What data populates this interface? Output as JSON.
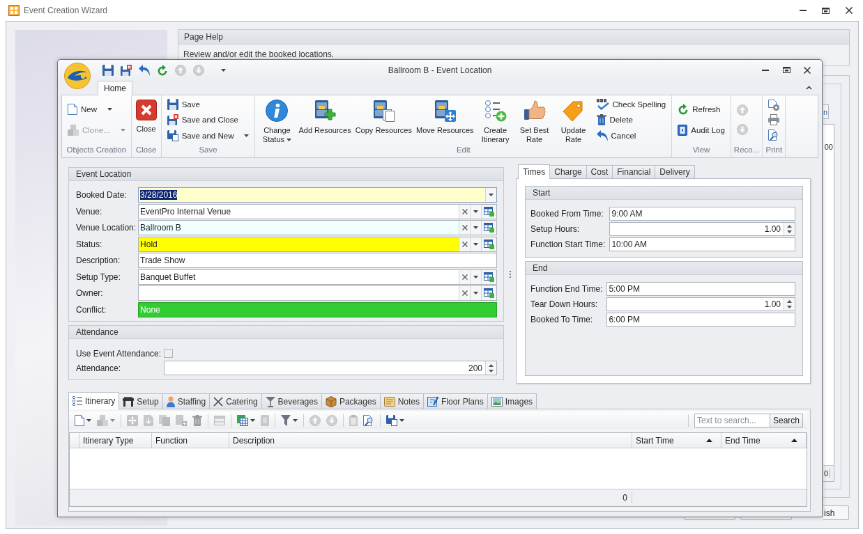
{
  "wizard": {
    "title": "Event Creation Wizard",
    "page_help": {
      "title": "Page Help",
      "text": "Review and/or edit the booked locations."
    },
    "background_panel": {
      "button": "n",
      "grid_cell": "00",
      "footer_count": "0"
    },
    "buttons": [
      {
        "kind": "covered"
      },
      {
        "kind": "covered"
      },
      {
        "kind": "labelled",
        "label": "ish"
      }
    ]
  },
  "window": {
    "title": "Ballroom B - Event Location",
    "quick_access": [
      {
        "disabled": false
      },
      {
        "disabled": false
      },
      {
        "disabled": false
      },
      {
        "disabled": false
      },
      {
        "disabled": true
      },
      {
        "disabled": true
      }
    ]
  },
  "ribbon": {
    "tabs": [
      {
        "label": "Home",
        "selected": true
      }
    ],
    "groups": [
      {
        "label": "Objects Creation",
        "items": [
          {
            "kind": "small",
            "label": "New",
            "dropdown": true,
            "disabled": false
          },
          {
            "kind": "small",
            "label": "Clone...",
            "dropdown": true,
            "disabled": true
          }
        ]
      },
      {
        "label": "Close",
        "items": [
          {
            "kind": "large",
            "label": "Close",
            "disabled": false
          }
        ]
      },
      {
        "label": "Save",
        "items": [
          {
            "kind": "small",
            "label": "Save",
            "disabled": false
          },
          {
            "kind": "small",
            "label": "Save and Close",
            "disabled": false
          },
          {
            "kind": "small",
            "label": "Save and New",
            "dropdown": true,
            "disabled": false
          }
        ]
      },
      {
        "label": "Edit",
        "items": [
          {
            "kind": "large",
            "label": "Change Status",
            "dropdown": true,
            "two_line": true,
            "disabled": false
          },
          {
            "kind": "large",
            "label": "Add Resources",
            "disabled": false
          },
          {
            "kind": "large",
            "label": "Copy Resources",
            "disabled": false
          },
          {
            "kind": "large",
            "label": "Move Resources",
            "disabled": false
          },
          {
            "kind": "large",
            "label": "Create Itinerary",
            "two_line": true,
            "disabled": false
          },
          {
            "kind": "large",
            "label": "Set Best Rate",
            "two_line": true,
            "disabled": false
          },
          {
            "kind": "large",
            "label": "Update Rate",
            "two_line": true,
            "disabled": false
          },
          {
            "kind": "small",
            "label": "Check Spelling",
            "disabled": false
          },
          {
            "kind": "small",
            "label": "Delete",
            "disabled": false
          },
          {
            "kind": "small",
            "label": "Cancel",
            "disabled": false
          }
        ]
      },
      {
        "label": "View",
        "items": [
          {
            "kind": "small",
            "label": "Refresh",
            "disabled": false
          },
          {
            "kind": "small",
            "label": "Audit Log",
            "disabled": false
          }
        ]
      },
      {
        "label": "Reco...",
        "items": [
          {
            "kind": "icon",
            "disabled": true
          },
          {
            "kind": "icon",
            "disabled": true
          }
        ]
      },
      {
        "label": "Print",
        "items": [
          {
            "kind": "icon",
            "disabled": false
          },
          {
            "kind": "icon",
            "disabled": false
          },
          {
            "kind": "icon",
            "disabled": false
          }
        ]
      }
    ]
  },
  "event_location": {
    "title": "Event Location",
    "fields": [
      {
        "label": "Booked Date:",
        "value": "3/28/2016",
        "kind": "date",
        "color": "#ffffcc",
        "highlighted": true
      },
      {
        "label": "Venue:",
        "value": "EventPro Internal Venue",
        "kind": "lookup",
        "color": "#ffffff",
        "highlighted": false
      },
      {
        "label": "Venue Location:",
        "value": "Ballroom B",
        "kind": "lookup",
        "color": "#f0ffff",
        "highlighted": false
      },
      {
        "label": "Status:",
        "value": "Hold",
        "kind": "lookup",
        "color": "#ffff00",
        "highlighted": false
      },
      {
        "label": "Description:",
        "value": "Trade Show",
        "kind": "text",
        "color": "#ffffff",
        "highlighted": false
      },
      {
        "label": "Setup Type:",
        "value": "Banquet Buffet",
        "kind": "lookup",
        "color": "#ffffff",
        "highlighted": false
      },
      {
        "label": "Owner:",
        "kind": "lookup",
        "color": "#ffffff",
        "highlighted": false
      },
      {
        "label": "Conflict:",
        "value": "None",
        "kind": "banner",
        "color": "#33cc33",
        "highlighted": false
      }
    ]
  },
  "attendance": {
    "title": "Attendance",
    "use_event_attendance": {
      "label": "Use Event Attendance:",
      "checked": false,
      "disabled": true
    },
    "attendance": {
      "label": "Attendance:",
      "value": "200"
    }
  },
  "detail_tabs": {
    "tabs": [
      {
        "label": "Times",
        "selected": true
      },
      {
        "label": "Charge",
        "selected": false
      },
      {
        "label": "Cost",
        "selected": false
      },
      {
        "label": "Financial",
        "selected": false
      },
      {
        "label": "Delivery",
        "selected": false
      }
    ],
    "groups": [
      {
        "title": "Start",
        "fields": [
          {
            "label": "Booked From Time:",
            "value": "9:00 AM",
            "kind": "text"
          },
          {
            "label": "Setup Hours:",
            "value": "1.00",
            "kind": "spin"
          },
          {
            "label": "Function Start Time:",
            "value": "10:00 AM",
            "kind": "text"
          }
        ]
      },
      {
        "title": "End",
        "fields": [
          {
            "label": "Function End Time:",
            "value": "5:00 PM",
            "kind": "text"
          },
          {
            "label": "Tear Down Hours:",
            "value": "1.00",
            "kind": "spin"
          },
          {
            "label": "Booked To Time:",
            "value": "6:00 PM",
            "kind": "text"
          }
        ]
      }
    ]
  },
  "itinerary": {
    "tabs": [
      {
        "label": "Itinerary",
        "selected": true
      },
      {
        "label": "Setup",
        "selected": false
      },
      {
        "label": "Staffing",
        "selected": false
      },
      {
        "label": "Catering",
        "selected": false
      },
      {
        "label": "Beverages",
        "selected": false
      },
      {
        "label": "Packages",
        "selected": false
      },
      {
        "label": "Notes",
        "selected": false
      },
      {
        "label": "Floor Plans",
        "selected": false
      },
      {
        "label": "Images",
        "selected": false
      }
    ],
    "toolbar": [
      {
        "kind": "button",
        "dropdown": true,
        "disabled": false
      },
      {
        "kind": "button",
        "dropdown": true,
        "disabled": true
      },
      {
        "kind": "separator"
      },
      {
        "kind": "button",
        "disabled": true
      },
      {
        "kind": "button",
        "disabled": true
      },
      {
        "kind": "button",
        "disabled": true
      },
      {
        "kind": "button",
        "disabled": true
      },
      {
        "kind": "button",
        "disabled": true
      },
      {
        "kind": "separator"
      },
      {
        "kind": "button",
        "disabled": true
      },
      {
        "kind": "separator"
      },
      {
        "kind": "button",
        "dropdown": true,
        "disabled": false
      },
      {
        "kind": "button",
        "disabled": true
      },
      {
        "kind": "separator"
      },
      {
        "kind": "button",
        "dropdown": true,
        "disabled": false
      },
      {
        "kind": "separator"
      },
      {
        "kind": "button",
        "disabled": true
      },
      {
        "kind": "button",
        "disabled": true
      },
      {
        "kind": "separator"
      },
      {
        "kind": "button",
        "disabled": true
      },
      {
        "kind": "button",
        "disabled": false
      },
      {
        "kind": "separator"
      },
      {
        "kind": "button",
        "dropdown": true,
        "disabled": false
      }
    ],
    "search": {
      "placeholder": "Text to search...",
      "button": "Search"
    },
    "columns": [
      {
        "label": "Itinerary Type",
        "sorted": false
      },
      {
        "label": "Function",
        "sorted": false
      },
      {
        "label": "Description",
        "sorted": false
      },
      {
        "label": "Start Time",
        "sorted": true
      },
      {
        "label": "End Time",
        "sorted": true
      }
    ],
    "footer_count": "0"
  }
}
